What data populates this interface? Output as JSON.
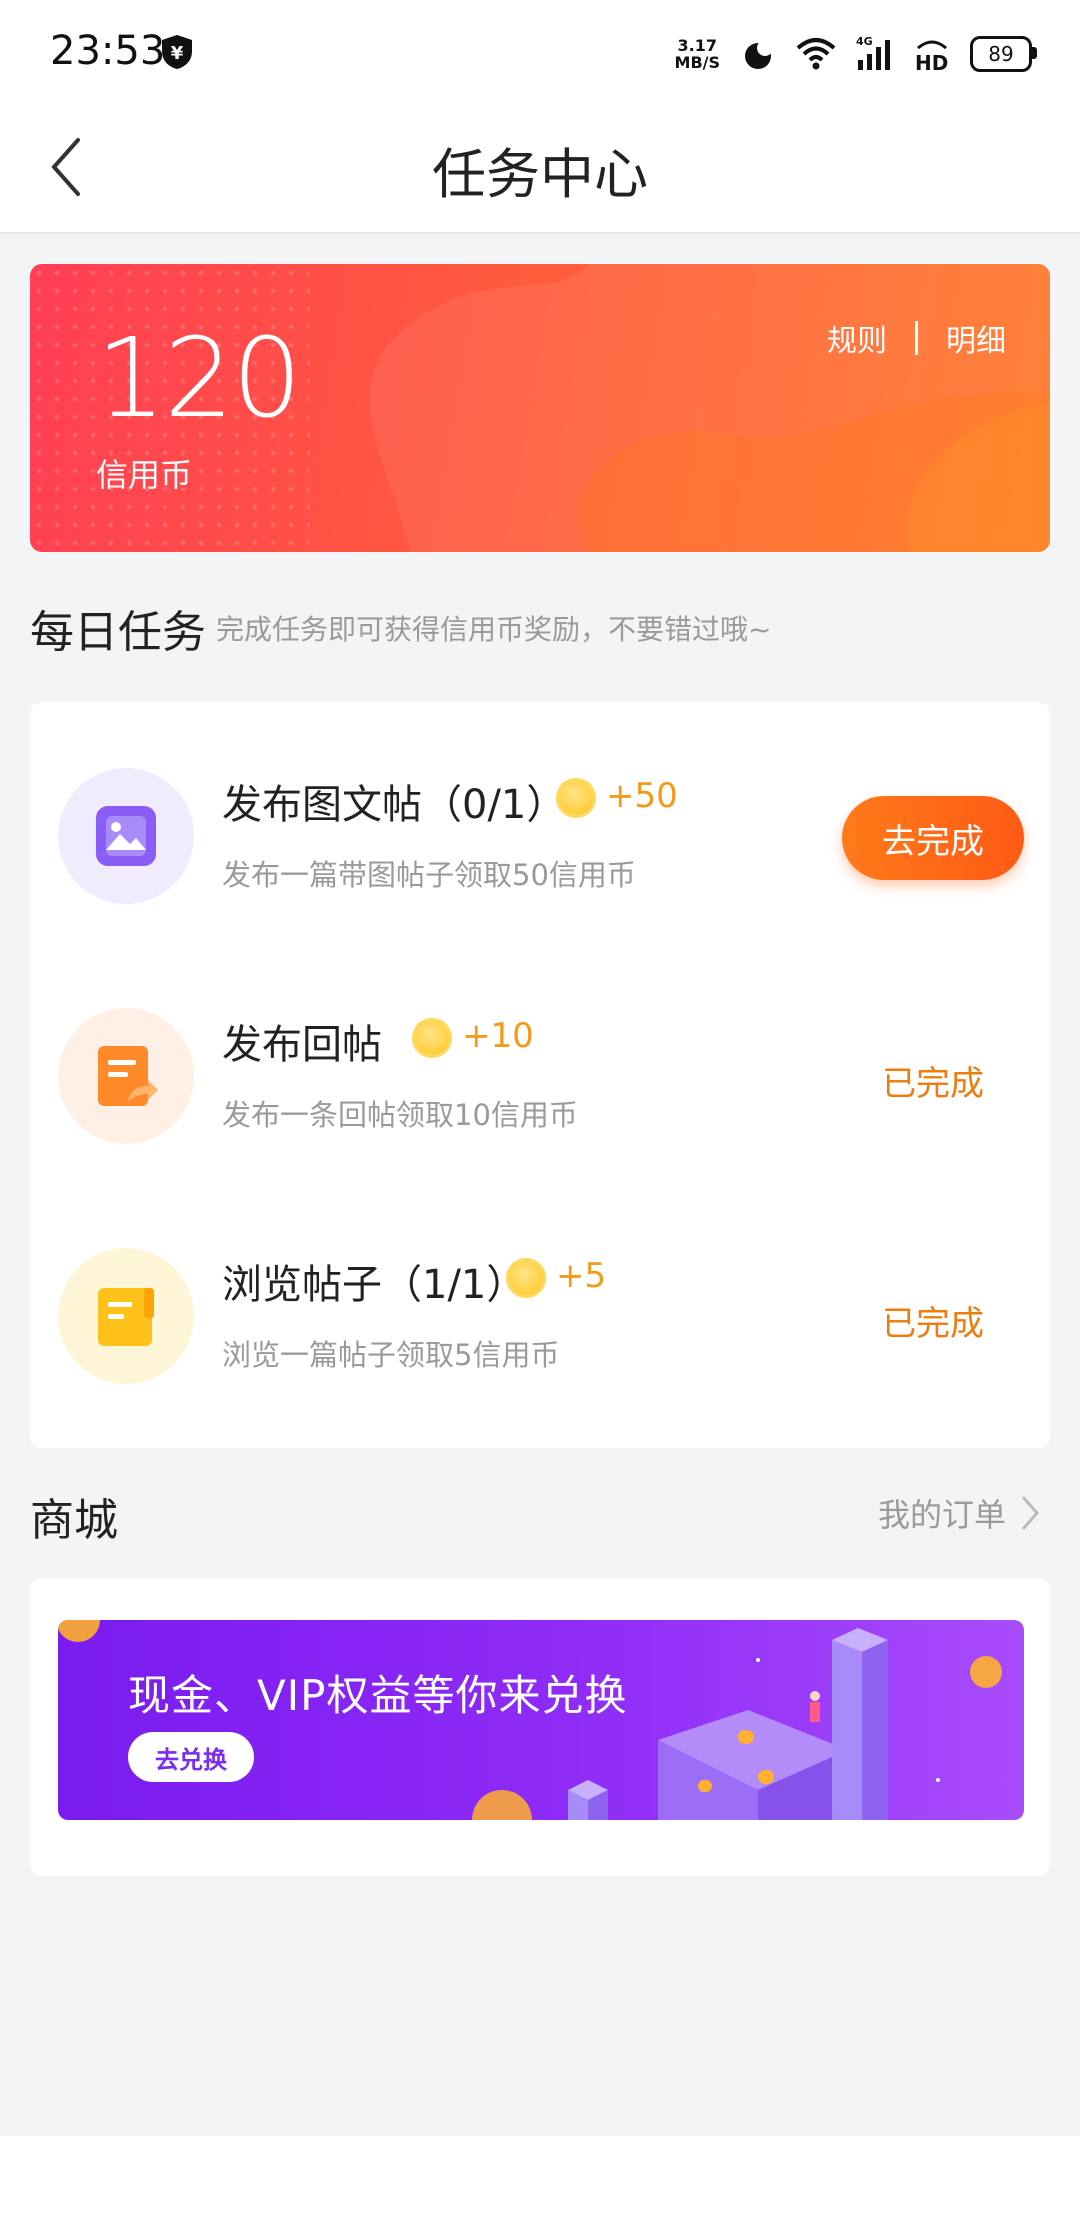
{
  "status_bar": {
    "time": "23:53",
    "net_speed_value": "3.17",
    "net_speed_unit": "MB/S",
    "battery": "89",
    "icons": [
      "shield-yen-icon",
      "moon-icon",
      "wifi-icon",
      "signal-4g-icon",
      "hd-icon",
      "battery-icon"
    ]
  },
  "header": {
    "title": "任务中心"
  },
  "credit": {
    "amount": "120",
    "label": "信用币",
    "rules_link": "规则",
    "details_link": "明细"
  },
  "daily": {
    "title": "每日任务",
    "subtitle": "完成任务即可获得信用币奖励，不要错过哦~",
    "tasks": [
      {
        "name": "发布图文帖（0/1）",
        "reward": "+50",
        "desc": "发布一篇带图帖子领取50信用币",
        "action": "去完成",
        "icon": "image-icon",
        "icon_color": "#8b5cf6"
      },
      {
        "name": "发布回帖",
        "reward": "+10",
        "desc": "发布一条回帖领取10信用币",
        "action": "已完成",
        "icon": "reply-doc-icon",
        "icon_color": "#ff8a2a"
      },
      {
        "name": "浏览帖子（1/1）",
        "reward": "+5",
        "desc": "浏览一篇帖子领取5信用币",
        "action": "已完成",
        "icon": "post-doc-icon",
        "icon_color": "#ffc21a"
      }
    ]
  },
  "store": {
    "title": "商城",
    "orders_link": "我的订单",
    "promo_text": "现金、VIP权益等你来兑换",
    "promo_button": "去兑换"
  },
  "colors": {
    "accent": "#ff6a1a",
    "done": "#f07c10",
    "reward": "#f49a1a",
    "promo": "#8f2cf6"
  }
}
